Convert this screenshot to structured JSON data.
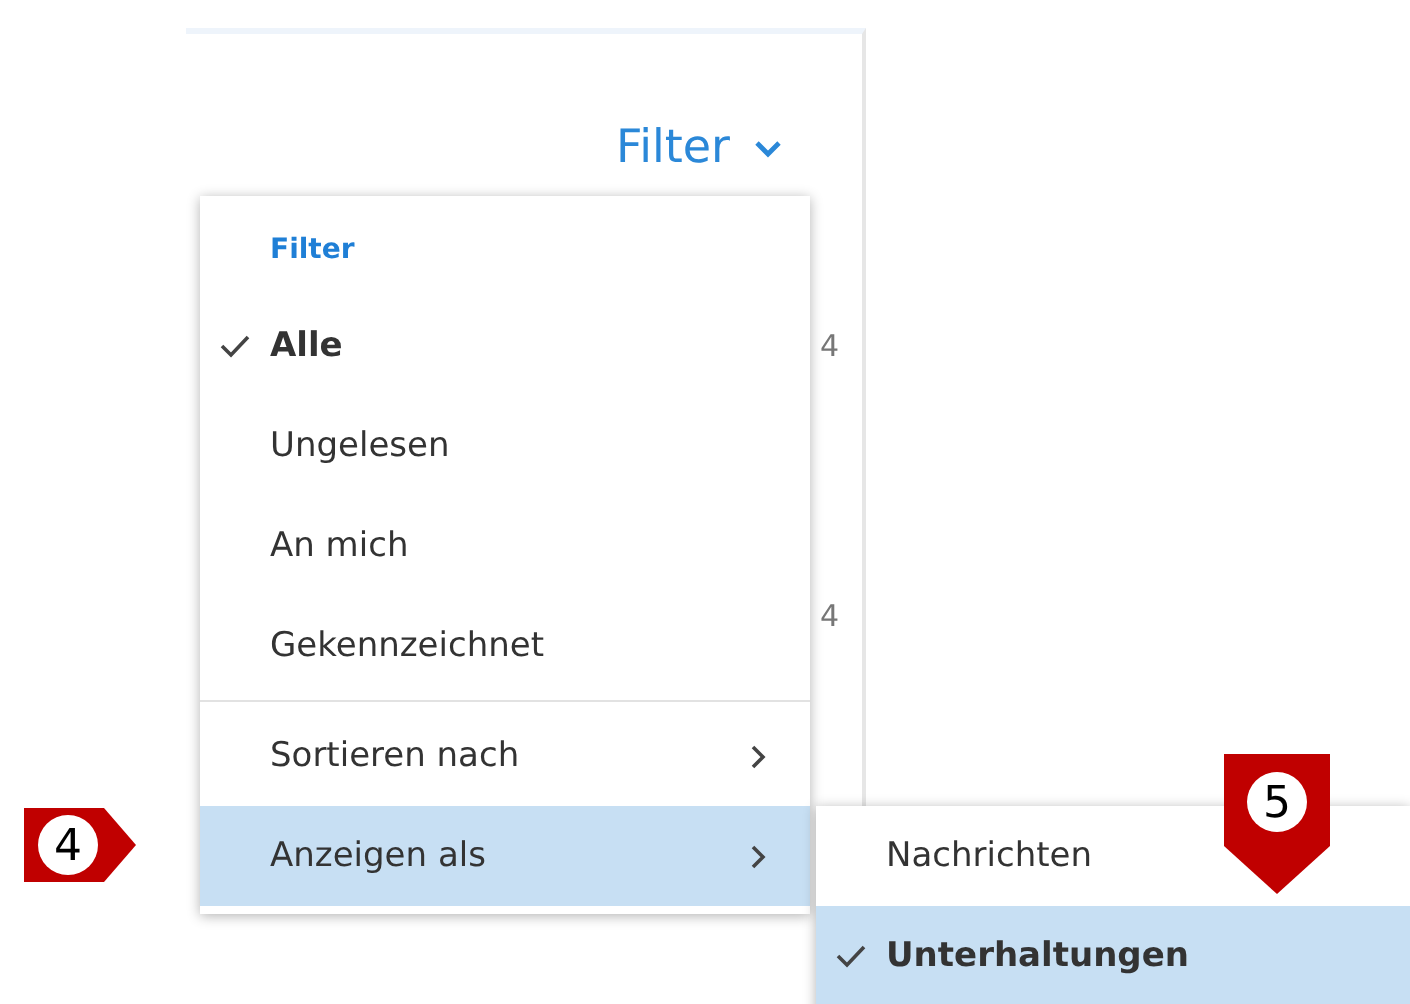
{
  "header": {
    "label": "Filter"
  },
  "background_fragments": [
    "4",
    "4"
  ],
  "menu": {
    "heading": "Filter",
    "filters": [
      {
        "label": "Alle",
        "selected": true
      },
      {
        "label": "Ungelesen",
        "selected": false
      },
      {
        "label": "An mich",
        "selected": false
      },
      {
        "label": "Gekennzeichnet",
        "selected": false
      }
    ],
    "submenus": [
      {
        "label": "Sortieren nach",
        "highlighted": false
      },
      {
        "label": "Anzeigen als",
        "highlighted": true
      }
    ]
  },
  "submenu": {
    "items": [
      {
        "label": "Nachrichten",
        "selected": false
      },
      {
        "label": "Unterhaltungen",
        "selected": true
      }
    ]
  },
  "callouts": [
    {
      "number": "4",
      "kind": "right"
    },
    {
      "number": "5",
      "kind": "down"
    }
  ]
}
